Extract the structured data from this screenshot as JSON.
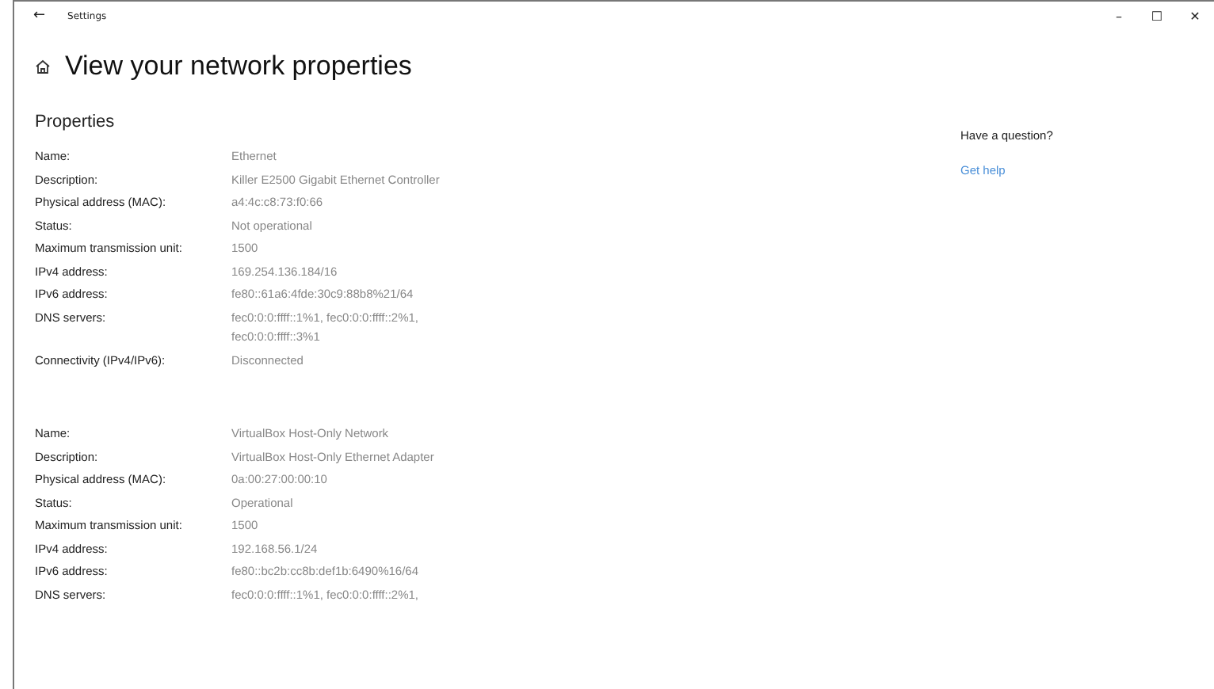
{
  "window": {
    "title": "Settings",
    "back": "←",
    "controls": [
      "–",
      "☐",
      "✕"
    ]
  },
  "page": {
    "title": "View your network properties"
  },
  "section": {
    "title": "Properties"
  },
  "adapters": [
    {
      "rows": [
        {
          "label": "Name:",
          "value": "Ethernet"
        },
        {
          "label": "Description:",
          "value": "Killer E2500 Gigabit Ethernet Controller"
        },
        {
          "label": "Physical address (MAC):",
          "value": "a4:4c:c8:73:f0:66"
        },
        {
          "label": "Status:",
          "value": "Not operational"
        },
        {
          "label": "Maximum transmission unit:",
          "value": "1500"
        },
        {
          "label": "IPv4 address:",
          "value": "169.254.136.184/16"
        },
        {
          "label": "IPv6 address:",
          "value": "fe80::61a6:4fde:30c9:88b8%21/64"
        },
        {
          "label": "DNS servers:",
          "value": "fec0:0:0:ffff::1%1, fec0:0:0:ffff::2%1, fec0:0:0:ffff::3%1"
        },
        {
          "label": "Connectivity (IPv4/IPv6):",
          "value": "Disconnected"
        }
      ]
    },
    {
      "rows": [
        {
          "label": "Name:",
          "value": "VirtualBox Host-Only Network"
        },
        {
          "label": "Description:",
          "value": "VirtualBox Host-Only Ethernet Adapter"
        },
        {
          "label": "Physical address (MAC):",
          "value": "0a:00:27:00:00:10"
        },
        {
          "label": "Status:",
          "value": "Operational"
        },
        {
          "label": "Maximum transmission unit:",
          "value": "1500"
        },
        {
          "label": "IPv4 address:",
          "value": "192.168.56.1/24"
        },
        {
          "label": "IPv6 address:",
          "value": "fe80::bc2b:cc8b:def1b:6490%16/64"
        },
        {
          "label": "DNS servers:",
          "value": "fec0:0:0:ffff::1%1, fec0:0:0:ffff::2%1,"
        }
      ]
    }
  ],
  "help": {
    "question": "Have a question?",
    "link": "Get help"
  }
}
